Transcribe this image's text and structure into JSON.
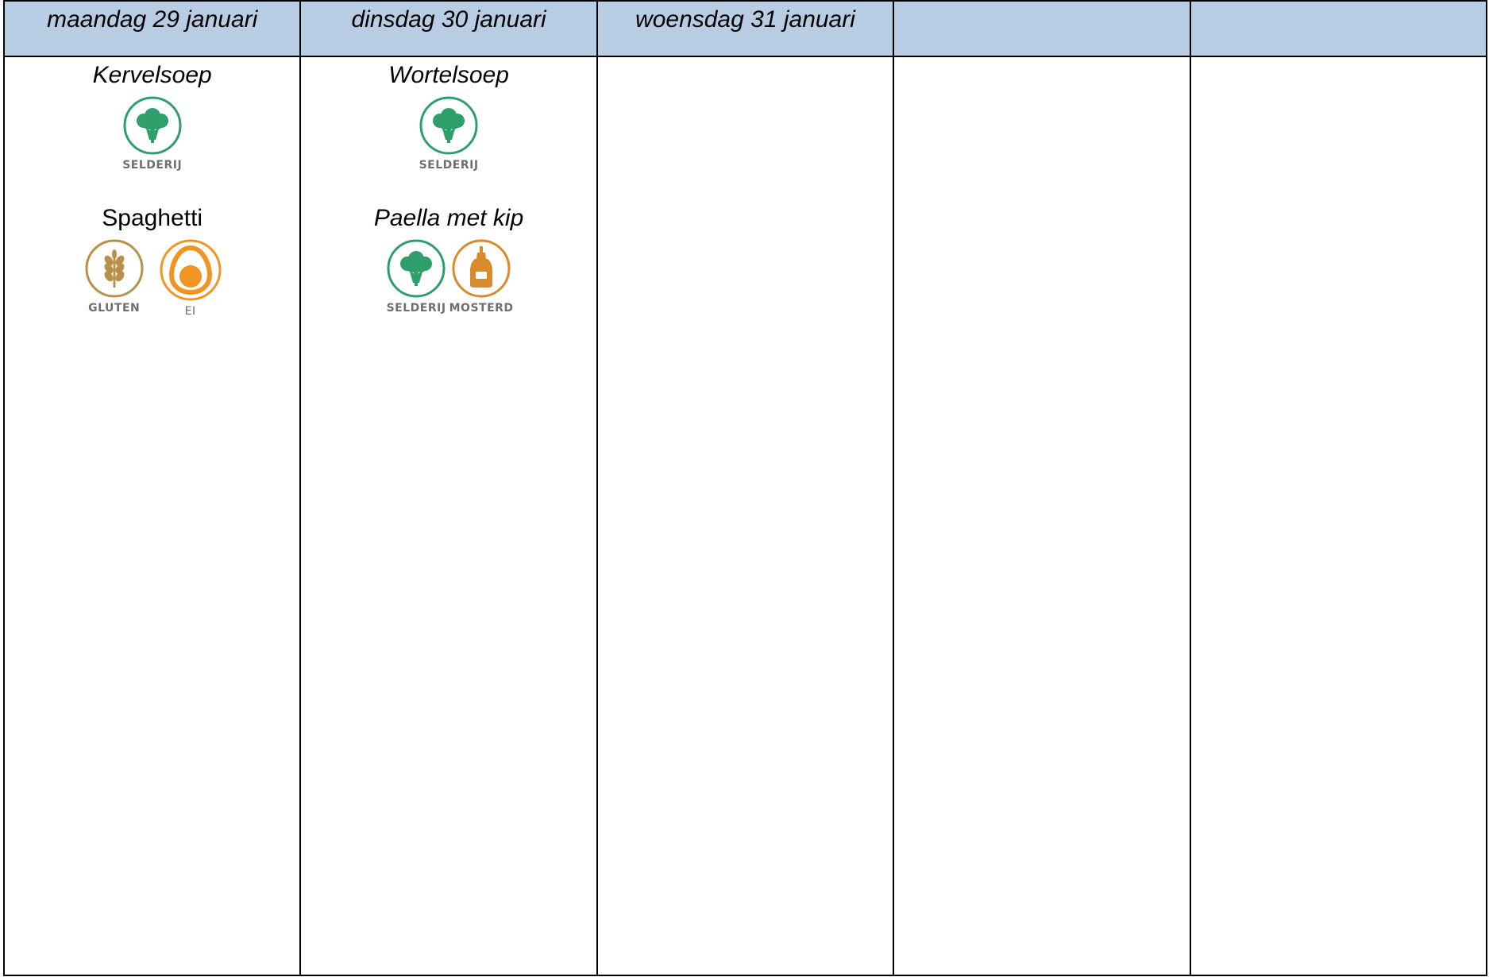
{
  "days": [
    {
      "label": "maandag 29 januari",
      "soup": {
        "name": "Kervelsoep",
        "allergens": [
          {
            "name": "SELDERIJ",
            "icon": "celery-icon"
          }
        ]
      },
      "main": {
        "name": "Spaghetti",
        "allergens": [
          {
            "name": "GLUTEN",
            "icon": "gluten-icon"
          },
          {
            "name": "EI",
            "icon": "egg-icon"
          }
        ]
      }
    },
    {
      "label": "dinsdag 30 januari",
      "soup": {
        "name": "Wortelsoep",
        "allergens": [
          {
            "name": "SELDERIJ",
            "icon": "celery-icon"
          }
        ]
      },
      "main": {
        "name": "Paella met kip",
        "allergens": [
          {
            "name": "SELDERIJ",
            "icon": "celery-icon"
          },
          {
            "name": "MOSTERD",
            "icon": "mustard-icon"
          }
        ]
      }
    },
    {
      "label": "woensdag 31 januari"
    },
    {
      "label": ""
    },
    {
      "label": ""
    }
  ],
  "colors": {
    "header_bg": "#b8cce4",
    "celery": "#2e9e6b",
    "gluten": "#b8904a",
    "egg": "#f39322",
    "mustard": "#d98a2b"
  }
}
